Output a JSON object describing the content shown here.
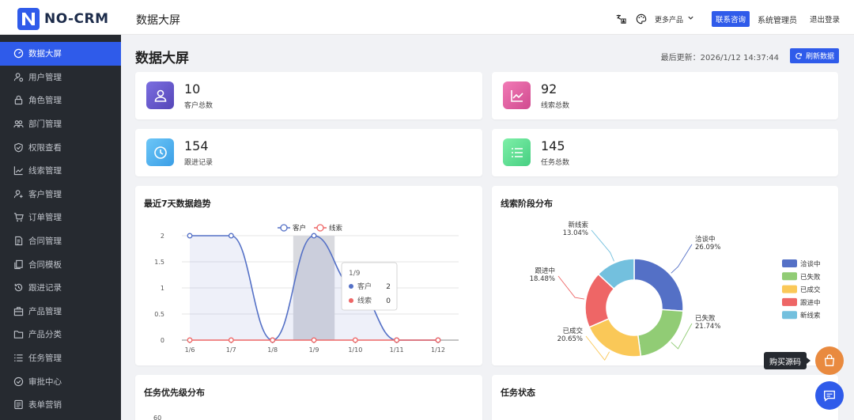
{
  "app": {
    "logo_text": "NO-CRM",
    "top_title": "数据大屏",
    "more_products": "更多产品",
    "contact_button": "联系咨询",
    "admin_name": "系统管理员",
    "logout": "退出登录"
  },
  "sidebar": {
    "items": [
      {
        "label": "数据大屏",
        "icon": "dashboard-icon",
        "active": true
      },
      {
        "label": "用户管理",
        "icon": "user-settings-icon",
        "active": false
      },
      {
        "label": "角色管理",
        "icon": "lock-icon",
        "active": false
      },
      {
        "label": "部门管理",
        "icon": "team-icon",
        "active": false
      },
      {
        "label": "权限查看",
        "icon": "shield-icon",
        "active": false
      },
      {
        "label": "线索管理",
        "icon": "trend-icon",
        "active": false
      },
      {
        "label": "客户管理",
        "icon": "customer-add-icon",
        "active": false
      },
      {
        "label": "订单管理",
        "icon": "cart-icon",
        "active": false
      },
      {
        "label": "合同管理",
        "icon": "contract-icon",
        "active": false
      },
      {
        "label": "合同模板",
        "icon": "template-icon",
        "active": false
      },
      {
        "label": "跟进记录",
        "icon": "history-icon",
        "active": false
      },
      {
        "label": "产品管理",
        "icon": "product-icon",
        "active": false
      },
      {
        "label": "产品分类",
        "icon": "folder-icon",
        "active": false
      },
      {
        "label": "任务管理",
        "icon": "list-icon",
        "active": false
      },
      {
        "label": "审批中心",
        "icon": "check-circle-icon",
        "active": false
      },
      {
        "label": "表单营销",
        "icon": "form-icon",
        "active": false
      }
    ]
  },
  "main": {
    "title": "数据大屏",
    "last_update": "最后更新：2026/1/12 14:37:44",
    "refresh_button": "刷新数据"
  },
  "stats": [
    {
      "value": "10",
      "label": "客户总数",
      "icon": "user-icon",
      "color": "#6a5fd0"
    },
    {
      "value": "92",
      "label": "线索总数",
      "icon": "chart-line-icon",
      "color": "#e25f9f"
    },
    {
      "value": "154",
      "label": "跟进记录",
      "icon": "clock-icon",
      "color": "#4fb2f0"
    },
    {
      "value": "145",
      "label": "任务总数",
      "icon": "list-icon",
      "color": "#5fdc92"
    }
  ],
  "panels": {
    "trend_title": "最近7天数据趋势",
    "stage_title": "线索阶段分布",
    "priority_title": "任务优先级分布",
    "task_status_title": "任务状态",
    "priority_axis_top": "60"
  },
  "chart_data": [
    {
      "type": "line",
      "title": "最近7天数据趋势",
      "x": [
        "1/6",
        "1/7",
        "1/8",
        "1/9",
        "1/10",
        "1/11",
        "1/12"
      ],
      "yticks": [
        "0",
        "0.5",
        "1",
        "1.5",
        "2"
      ],
      "ylim": [
        0,
        2
      ],
      "series": [
        {
          "name": "客户",
          "color": "#5470c6",
          "values": [
            2,
            2,
            0,
            2,
            1,
            0,
            0
          ]
        },
        {
          "name": "线索",
          "color": "#ee6666",
          "values": [
            0,
            0,
            0,
            0,
            0,
            0,
            0
          ]
        }
      ],
      "legend": "top-center",
      "tooltip": {
        "title": "1/9",
        "rows": [
          {
            "name": "客户",
            "value": "2"
          },
          {
            "name": "线索",
            "value": "0"
          }
        ]
      }
    },
    {
      "type": "pie",
      "title": "线索阶段分布",
      "slices": [
        {
          "name": "洽谈中",
          "value": 26.09,
          "label": "洽谈中",
          "pct": "26.09%",
          "color": "#5470c6"
        },
        {
          "name": "已失败",
          "value": 21.74,
          "label": "已失败",
          "pct": "21.74%",
          "color": "#91cc75"
        },
        {
          "name": "已成交",
          "value": 20.65,
          "label": "已成交",
          "pct": "20.65%",
          "color": "#fac858"
        },
        {
          "name": "跟进中",
          "value": 18.48,
          "label": "跟进中",
          "pct": "18.48%",
          "color": "#ee6666"
        },
        {
          "name": "新线索",
          "value": 13.04,
          "label": "新线索",
          "pct": "13.04%",
          "color": "#73c0de"
        }
      ],
      "legend": "right"
    }
  ],
  "floating": {
    "buy_tip": "购买源码"
  }
}
